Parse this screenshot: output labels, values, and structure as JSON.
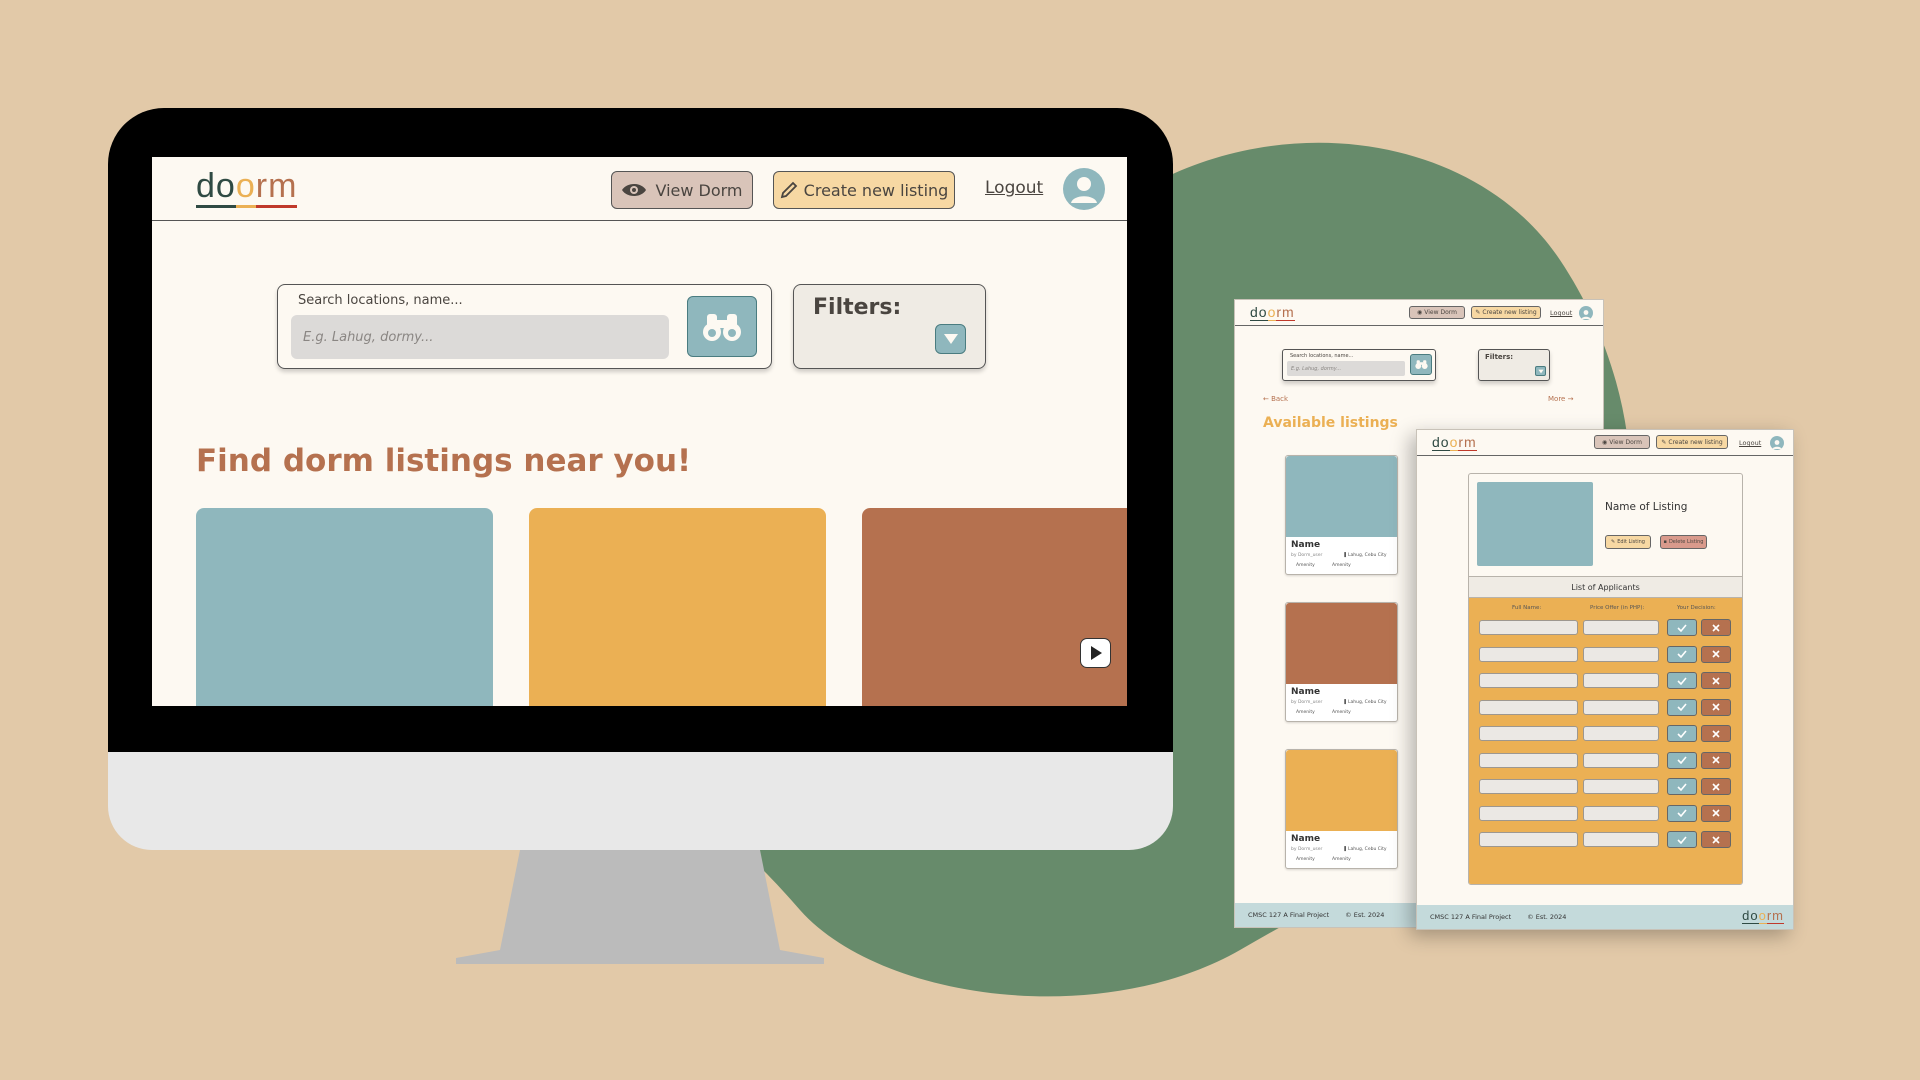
{
  "brand": {
    "logo_text": "doorm"
  },
  "main": {
    "nav": {
      "view_dorm": "View Dorm",
      "create_listing": "Create new listing",
      "logout": "Logout"
    },
    "search": {
      "label": "Search locations, name...",
      "placeholder": "E.g. Lahug, dormy..."
    },
    "filters": {
      "label": "Filters:"
    },
    "heading": "Find dorm listings near you!"
  },
  "listings_page": {
    "nav": {
      "view_dorm": "View Dorm",
      "create_listing": "Create new listing",
      "logout": "Logout"
    },
    "search": {
      "label": "Search locations, name...",
      "placeholder": "E.g. Lahug, dormy..."
    },
    "filters": {
      "label": "Filters:"
    },
    "back": "← Back",
    "more": "More →",
    "heading": "Available listings",
    "cards": [
      {
        "name": "Name",
        "owner": "by Dorm_user",
        "location": "Lahug, Cebu City",
        "amenity1": "Amenity",
        "amenity2": "Amenity",
        "color": "#8fb7bd"
      },
      {
        "name": "Name",
        "owner": "by Dorm_user",
        "location": "Lahug, Cebu City",
        "amenity1": "Amenity",
        "amenity2": "Amenity",
        "color": "#b5714f"
      },
      {
        "name": "Name",
        "owner": "by Dorm_user",
        "location": "Lahug, Cebu City",
        "amenity1": "Amenity",
        "amenity2": "Amenity",
        "color": "#ebb054"
      }
    ],
    "footer": {
      "project": "CMSC 127 A Final Project",
      "est": "© Est. 2024"
    }
  },
  "applicants_page": {
    "nav": {
      "view_dorm": "View Dorm",
      "create_listing": "Create new listing",
      "logout": "Logout"
    },
    "listing_name": "Name of Listing",
    "edit": "Edit Listing",
    "delete": "Delete Listing",
    "list_title": "List of Applicants",
    "columns": {
      "full_name": "Full Name:",
      "price_offer": "Price Offer (in PHP):",
      "decision": "Your Decision:"
    },
    "footer": {
      "project": "CMSC 127 A Final Project",
      "est": "© Est. 2024"
    }
  },
  "colors": {
    "bg": "#e2c9a8",
    "green": "#678b6b",
    "teal": "#8fb7bd",
    "orange": "#ebb054",
    "rust": "#b5714f",
    "cream": "#fdf9f2",
    "logo_dark": "#2f4a43",
    "logo_red": "#c0392b"
  }
}
